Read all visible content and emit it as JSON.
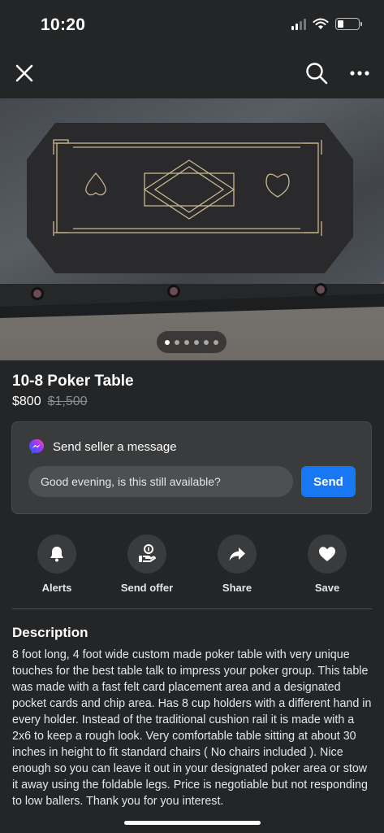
{
  "status_bar": {
    "time": "10:20",
    "battery_level": 0.3
  },
  "nav": {
    "close_icon": "close-icon",
    "search_icon": "search-icon",
    "more_icon": "more-icon"
  },
  "photo": {
    "page_count": 6,
    "current_index": 0
  },
  "listing": {
    "title": "10-8 Poker Table",
    "price": "$800",
    "original_price": "$1,500"
  },
  "message": {
    "heading": "Send seller a message",
    "input_value": "Good evening, is this still available?",
    "send_label": "Send",
    "accent": "#1877f2"
  },
  "actions": [
    {
      "label": "Alerts",
      "icon": "bell-icon"
    },
    {
      "label": "Send offer",
      "icon": "offer-icon"
    },
    {
      "label": "Share",
      "icon": "share-icon"
    },
    {
      "label": "Save",
      "icon": "heart-icon"
    }
  ],
  "description": {
    "heading": "Description",
    "text": "8 foot long, 4 foot wide custom made poker table with very unique touches for the best table talk to impress your poker group. This table was made with a fast felt card placement area and a designated pocket cards and chip area. Has 8 cup holders with a different hand in every holder. Instead of the traditional cushion rail it is made with a 2x6 to keep a rough look. Very comfortable table sitting at about 30 inches in height to fit standard chairs ( No chairs included ). Nice enough so you can leave it out in your designated poker area or stow it away using the foldable legs. Price is negotiable but not responding to low ballers. Thank you for you interest."
  }
}
